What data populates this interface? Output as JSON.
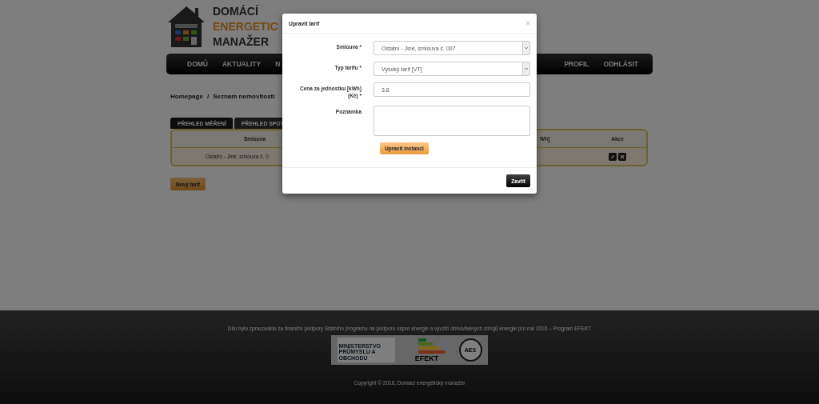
{
  "logo": {
    "lines": [
      "DOMÁCÍ",
      "ENERGETIC",
      "MANAŽER"
    ]
  },
  "nav": {
    "left": [
      "DOMŮ",
      "AKTUALITY",
      "N"
    ],
    "right": [
      "PROFIL",
      "ODHLÁSIT"
    ]
  },
  "breadcrumb": {
    "items": [
      "Homepage",
      "Seznam nemovitostí"
    ],
    "separator": "/"
  },
  "tabs": [
    {
      "label": "PŘEHLED MĚŘENÍ",
      "selected": true
    },
    {
      "label": "PŘEHLED SPOT",
      "selected": false
    }
  ],
  "table": {
    "columns": [
      "Smlouva",
      "Wh]",
      "Akce"
    ],
    "rows": [
      {
        "cells": [
          "Ostatní - Jiné, smlouva č. 0"
        ]
      }
    ]
  },
  "new_button": "Nový tarif",
  "footer": {
    "note": "Dílo bylo zpracováno za finanční podpory Státního programu na podporu úspor energie a využití obnovitelných zdrojů energie pro rok 2016 – Program EFEKT",
    "logos": [
      "MINISTERSTVO PRŮMYSLU A OBCHODU",
      "EFEKT",
      "AES"
    ],
    "copyright": "Copyright © 2016, Domácí energetický manažer"
  },
  "modal": {
    "title": "Upravit tarif",
    "close": "×",
    "fields": [
      {
        "kind": "select",
        "label": "Smlouva *",
        "value": "Ostatní - Jiné, smlouva č. 007"
      },
      {
        "kind": "select",
        "label": "Typ tarifu *",
        "value": "Vysoký tarif [VT]"
      },
      {
        "kind": "input",
        "label": "Cena za jednostku [kWh] (Kč) *",
        "value": "3.8"
      },
      {
        "kind": "textarea",
        "label": "Poznámka"
      }
    ],
    "submit": "Upravit instanci",
    "close_button": "Zavřít"
  }
}
